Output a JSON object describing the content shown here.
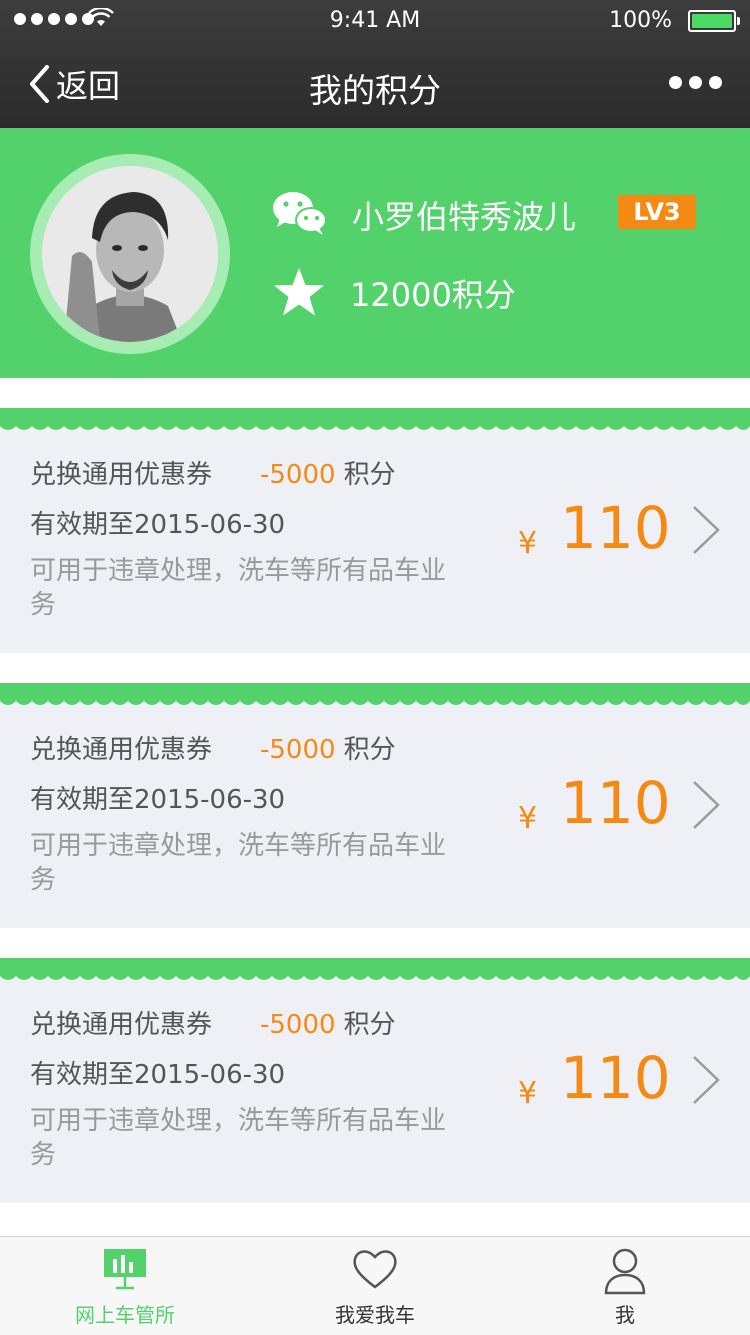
{
  "status_bar": {
    "time": "9:41 AM",
    "battery": "100%"
  },
  "nav": {
    "back_label": "返回",
    "title": "我的积分"
  },
  "profile": {
    "nickname": "小罗伯特秀波儿",
    "level": "LV3",
    "points": "12000积分"
  },
  "coupons": [
    {
      "title": "兑换通用优惠券",
      "cost": "-5000",
      "cost_unit": "积分",
      "expire": "有效期至2015-06-30",
      "description": "可用于违章处理，洗车等所有品车业务",
      "currency": "¥",
      "amount": "110"
    },
    {
      "title": "兑换通用优惠券",
      "cost": "-5000",
      "cost_unit": "积分",
      "expire": "有效期至2015-06-30",
      "description": "可用于违章处理，洗车等所有品车业务",
      "currency": "¥",
      "amount": "110"
    },
    {
      "title": "兑换通用优惠券",
      "cost": "-5000",
      "cost_unit": "积分",
      "expire": "有效期至2015-06-30",
      "description": "可用于违章处理，洗车等所有品车业务",
      "currency": "¥",
      "amount": "110"
    }
  ],
  "tabs": [
    {
      "label": "网上车管所",
      "icon": "chart-icon",
      "active": true
    },
    {
      "label": "我爱我车",
      "icon": "heart-icon",
      "active": false
    },
    {
      "label": "我",
      "icon": "user-icon",
      "active": false
    }
  ],
  "colors": {
    "brand_green": "#53d26b",
    "accent_orange": "#f48a14",
    "card_bg": "#eff0f5",
    "nav_bg": "#333333"
  }
}
